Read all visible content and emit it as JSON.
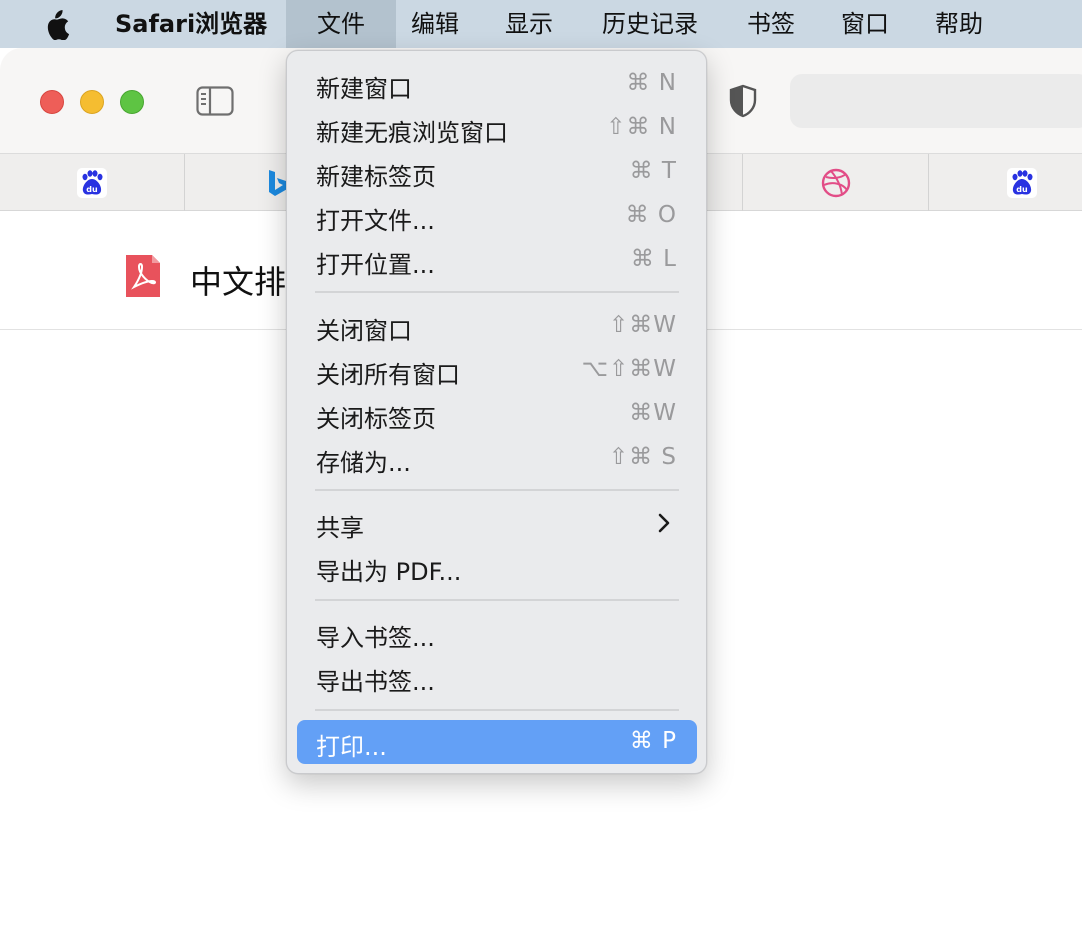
{
  "menubar": {
    "app_name": "Safari浏览器",
    "items": [
      "文件",
      "编辑",
      "显示",
      "历史记录",
      "书签",
      "窗口",
      "帮助"
    ]
  },
  "document": {
    "title": "中文排"
  },
  "file_menu": {
    "items": [
      {
        "label": "新建窗口",
        "shortcut": "⌘ N"
      },
      {
        "label": "新建无痕浏览窗口",
        "shortcut": "⇧⌘ N"
      },
      {
        "label": "新建标签页",
        "shortcut": "⌘ T"
      },
      {
        "label": "打开文件...",
        "shortcut": "⌘ O"
      },
      {
        "label": "打开位置...",
        "shortcut": "⌘ L"
      },
      {
        "label": "关闭窗口",
        "shortcut": "⇧⌘W"
      },
      {
        "label": "关闭所有窗口",
        "shortcut": "⌥⇧⌘W"
      },
      {
        "label": "关闭标签页",
        "shortcut": "⌘W"
      },
      {
        "label": "存储为...",
        "shortcut": "⇧⌘ S"
      },
      {
        "label": "共享",
        "shortcut": ""
      },
      {
        "label": "导出为 PDF...",
        "shortcut": ""
      },
      {
        "label": "导入书签...",
        "shortcut": ""
      },
      {
        "label": "导出书签...",
        "shortcut": ""
      },
      {
        "label": "打印...",
        "shortcut": "⌘ P"
      }
    ],
    "highlighted": "打印...",
    "highlight_color": "#63a0f6"
  },
  "favorites": [
    "baidu-icon",
    "bing-icon",
    "dribbble-icon",
    "baidu-icon"
  ],
  "colors": {
    "menubar_bg": "#cbd8e3",
    "close": "#ee5e58",
    "minimize": "#f5bd31",
    "zoom": "#5ec443",
    "pdf_icon": "#e8525c"
  }
}
